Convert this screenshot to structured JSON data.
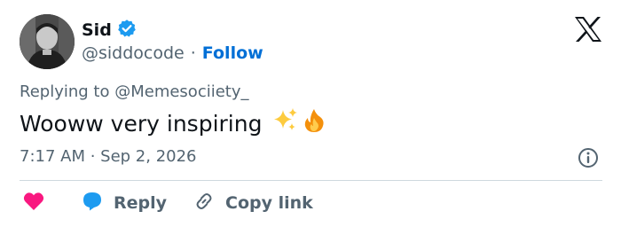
{
  "user": {
    "display_name": "Sid",
    "handle": "@siddocode",
    "verified": true,
    "follow_label": "Follow",
    "separator": "·"
  },
  "brand": {
    "logo_icon": "x-logo-icon"
  },
  "tweet": {
    "replying_prefix": "Replying to",
    "replying_to": "@Memesociiety_",
    "text": "Wooww very inspiring",
    "emojis": [
      "sparkles-emoji",
      "fire-emoji"
    ],
    "timestamp": "7:17 AM · Sep 2, 2026"
  },
  "actions": {
    "like_icon": "heart-icon",
    "reply_label": "Reply",
    "copy_link_label": "Copy link"
  },
  "colors": {
    "text": "#0f1419",
    "muted": "#536471",
    "accent": "#006fd6",
    "verified": "#1d9bf0",
    "like": "#f91880",
    "divider": "#cfd9de"
  }
}
